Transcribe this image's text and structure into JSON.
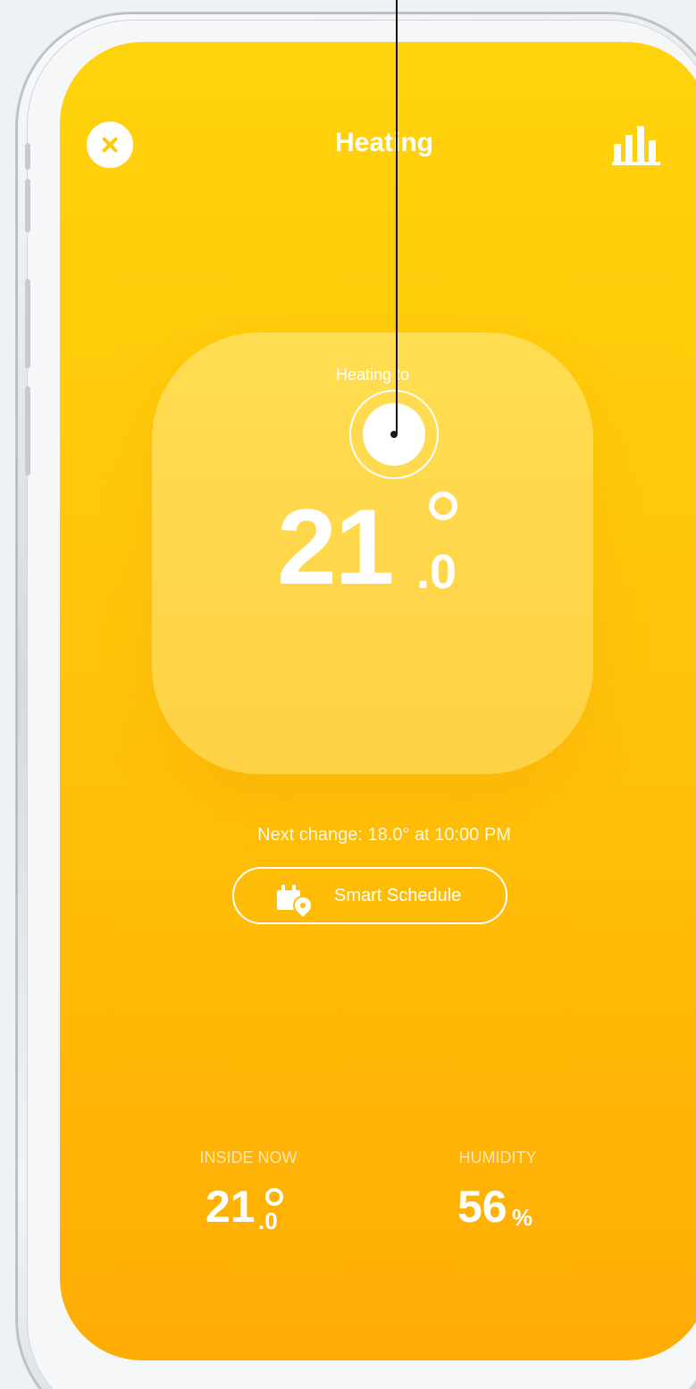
{
  "header": {
    "title": "Heating",
    "close_icon": "close-icon",
    "stats_icon": "bar-chart-icon"
  },
  "target": {
    "label": "Heating to",
    "value_int": "21",
    "value_dec": ".0"
  },
  "next_change": "Next change: 18.0° at 10:00 PM",
  "schedule": {
    "label": "Smart Schedule",
    "icon": "calendar-location-icon"
  },
  "stats": {
    "inside_label": "INSIDE NOW",
    "inside_int": "21",
    "inside_dec": ".0",
    "humidity_label": "HUMIDITY",
    "humidity_value": "56",
    "humidity_unit": "%"
  },
  "colors": {
    "screen_top": "#ffd30b",
    "screen_bottom": "#ffac05",
    "text": "#ffffff"
  }
}
